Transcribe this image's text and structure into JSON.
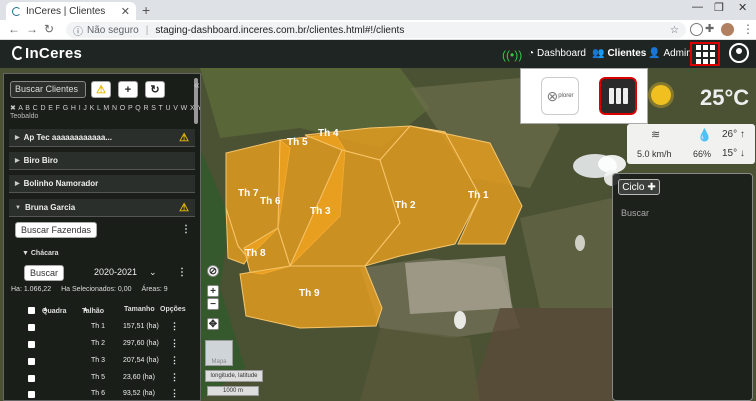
{
  "browser": {
    "tab_title": "InCeres | Clientes",
    "insecure_label": "Não seguro",
    "url": "staging-dashboard.inceres.com.br/clientes.html#!/clients"
  },
  "appbar": {
    "logo": "InCeres",
    "nav": [
      {
        "label": "Dashboard"
      },
      {
        "label": "Clientes"
      },
      {
        "label": "Admin"
      }
    ]
  },
  "panel": {
    "search_placeholder": "Buscar Clientes",
    "alphabet": "✖ A B C D E F G H I J K L M N O P Q R S T U V W X Y Z",
    "partial_row": "Teobaldo",
    "clients": [
      {
        "name": "Ap Tec aaaaaaaaaaaa...",
        "warn": true
      },
      {
        "name": "Biro Biro",
        "warn": false
      },
      {
        "name": "Bolinho Namorador",
        "warn": false
      },
      {
        "name": "Bruna Garcia",
        "warn": true
      }
    ],
    "search_farms": "Buscar Fazendas",
    "farm_name": "Chácara",
    "search_btn": "Buscar",
    "season": "2020-2021",
    "stats": {
      "area": "Ha: 1.066,22",
      "selected": "Ha Selecionados: 0,00",
      "areas": "Áreas: 9"
    },
    "table_headers": {
      "quadra": "Quadra",
      "talhao": "Talhão",
      "tamanho": "Tamanho",
      "opcoes": "Opções"
    },
    "rows": [
      {
        "name": "Th 1",
        "size": "157,51 (ha)"
      },
      {
        "name": "Th 2",
        "size": "297,60 (ha)"
      },
      {
        "name": "Th 3",
        "size": "207,54 (ha)"
      },
      {
        "name": "Th 5",
        "size": "23,60 (ha)"
      },
      {
        "name": "Th 6",
        "size": "93,52 (ha)"
      }
    ]
  },
  "map": {
    "field_labels": [
      "Th 1",
      "Th 2",
      "Th 3",
      "Th 4",
      "Th 5",
      "Th 6",
      "Th 7",
      "Th 8",
      "Th 9"
    ],
    "field_color": "#f0a21e",
    "coord_label": "longitude, latitude",
    "scale_label": "1000 m",
    "thumb_label": "Mapa"
  },
  "apps": {
    "xplorer_label": "plorer"
  },
  "weather": {
    "temp": "25°C",
    "wind": "5.0 km/h",
    "humidity": "66%",
    "tmax": "26°",
    "tmin": "15°"
  },
  "ciclo": {
    "button": "Ciclo",
    "search": "Buscar"
  }
}
